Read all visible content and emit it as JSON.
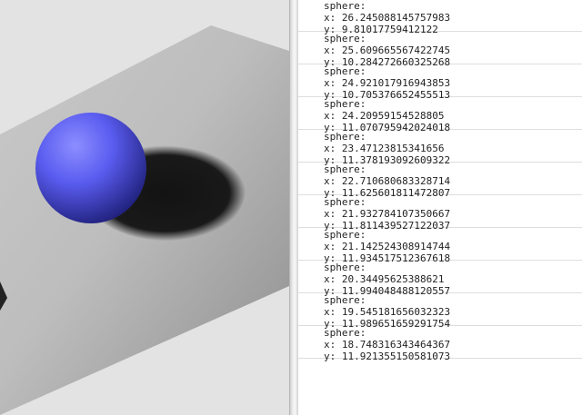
{
  "scene": {
    "background_color": "#e4e3e3",
    "plane_color": "#bdbdbd",
    "sphere_color": "#5a5cf0",
    "shadow_color": "#111111"
  },
  "console": {
    "label": "sphere:",
    "entries": [
      {
        "x": "26.245088145757983",
        "y": "9.81017759412122"
      },
      {
        "x": "25.609665567422745",
        "y": "10.284272660325268"
      },
      {
        "x": "24.921017916943853",
        "y": "10.705376652455513"
      },
      {
        "x": "24.20959154528805",
        "y": "11.070795942024018"
      },
      {
        "x": "23.47123815341656",
        "y": "11.378193092609322"
      },
      {
        "x": "22.710680683328714",
        "y": "11.625601811472807"
      },
      {
        "x": "21.932784107350667",
        "y": "11.811439527122037"
      },
      {
        "x": "21.142524308914744",
        "y": "11.934517512367618"
      },
      {
        "x": "20.34495625388621",
        "y": "11.994048488120557"
      },
      {
        "x": "19.545181656032323",
        "y": "11.989651659291754"
      },
      {
        "x": "18.748316343464367",
        "y": "11.921355150581073"
      }
    ]
  }
}
